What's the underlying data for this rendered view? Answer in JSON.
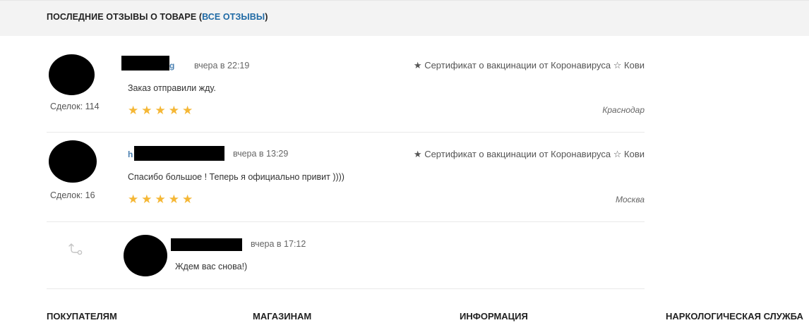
{
  "section": {
    "title_prefix": "Последние отзывы о товаре (",
    "all_reviews_link": "ВСЕ ОТЗЫВЫ",
    "title_suffix": ")"
  },
  "reviews": [
    {
      "name_visible_suffix": "g",
      "time": "вчера в 22:19",
      "product": "★ Сертификат о вакцинации от Коронавируса ☆ Кови",
      "text": "Заказ отправили жду.",
      "deals": "Сделок: 114",
      "rating": 5,
      "stars": "★★★★★",
      "city": "Краснодар"
    },
    {
      "name_visible_prefix": "h",
      "time": "вчера в 13:29",
      "product": "★ Сертификат о вакцинации от Коронавируса ☆ Кови",
      "text": "Спасибо большое ! Теперь я официально привит ))))",
      "deals": "Сделок: 16",
      "rating": 5,
      "stars": "★★★★★",
      "city": "Москва"
    }
  ],
  "reply": {
    "time": "вчера в 17:12",
    "text": "Ждем вас снова!)"
  },
  "footer": {
    "columns": [
      "Покупателям",
      "Магазинам",
      "Информация",
      "Наркологическая служба"
    ]
  },
  "colors": {
    "link": "#1f6aa5",
    "star": "#f5b735",
    "header_bg": "#f3f3f3"
  },
  "icons": [
    "reply-arrow-icon",
    "star-icon"
  ]
}
